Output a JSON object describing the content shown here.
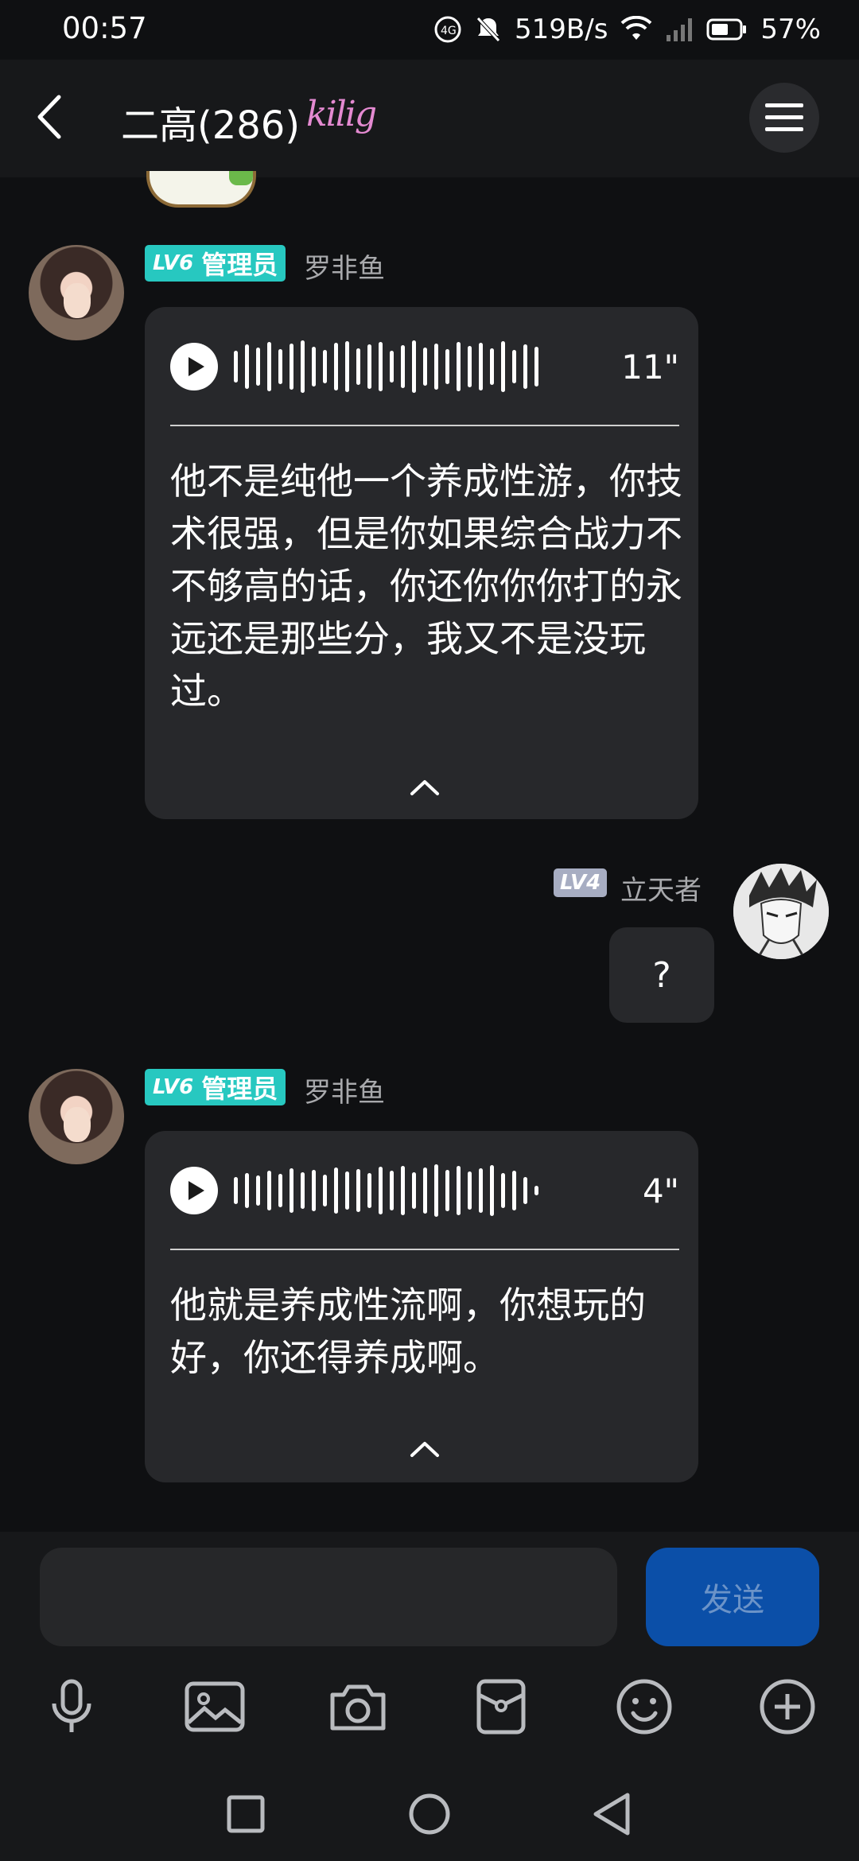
{
  "status_bar": {
    "time": "00:57",
    "speed": "519B/s",
    "battery": "57%"
  },
  "header": {
    "title": "二高(286)",
    "sticker_text": "kilig"
  },
  "messages": [
    {
      "badge_level": "LV6",
      "badge_role": "管理员",
      "sender": "罗非鱼",
      "duration": "11\"",
      "transcript": "他不是纯他一个养成性游，你技术很强，但是你如果综合战力不不够高的话，你还你你你打的永远还是那些分，我又不是没玩过。"
    },
    {
      "badge_level": "LV4",
      "sender": "立天者",
      "text": "?"
    },
    {
      "badge_level": "LV6",
      "badge_role": "管理员",
      "sender": "罗非鱼",
      "duration": "4\"",
      "transcript": "他就是养成性流啊，你想玩的好，你还得养成啊。"
    }
  ],
  "input": {
    "placeholder": "",
    "send_label": "发送"
  },
  "toolbar": [
    "mic-icon",
    "image-icon",
    "camera-icon",
    "red-packet-icon",
    "emoji-icon",
    "plus-icon"
  ],
  "nav": [
    "recents-icon",
    "home-icon",
    "back-icon"
  ],
  "colors": {
    "admin_badge": "#27c8c0",
    "send_button": "#0b4fa8",
    "background": "#0f1012",
    "bubble": "#27282b"
  }
}
